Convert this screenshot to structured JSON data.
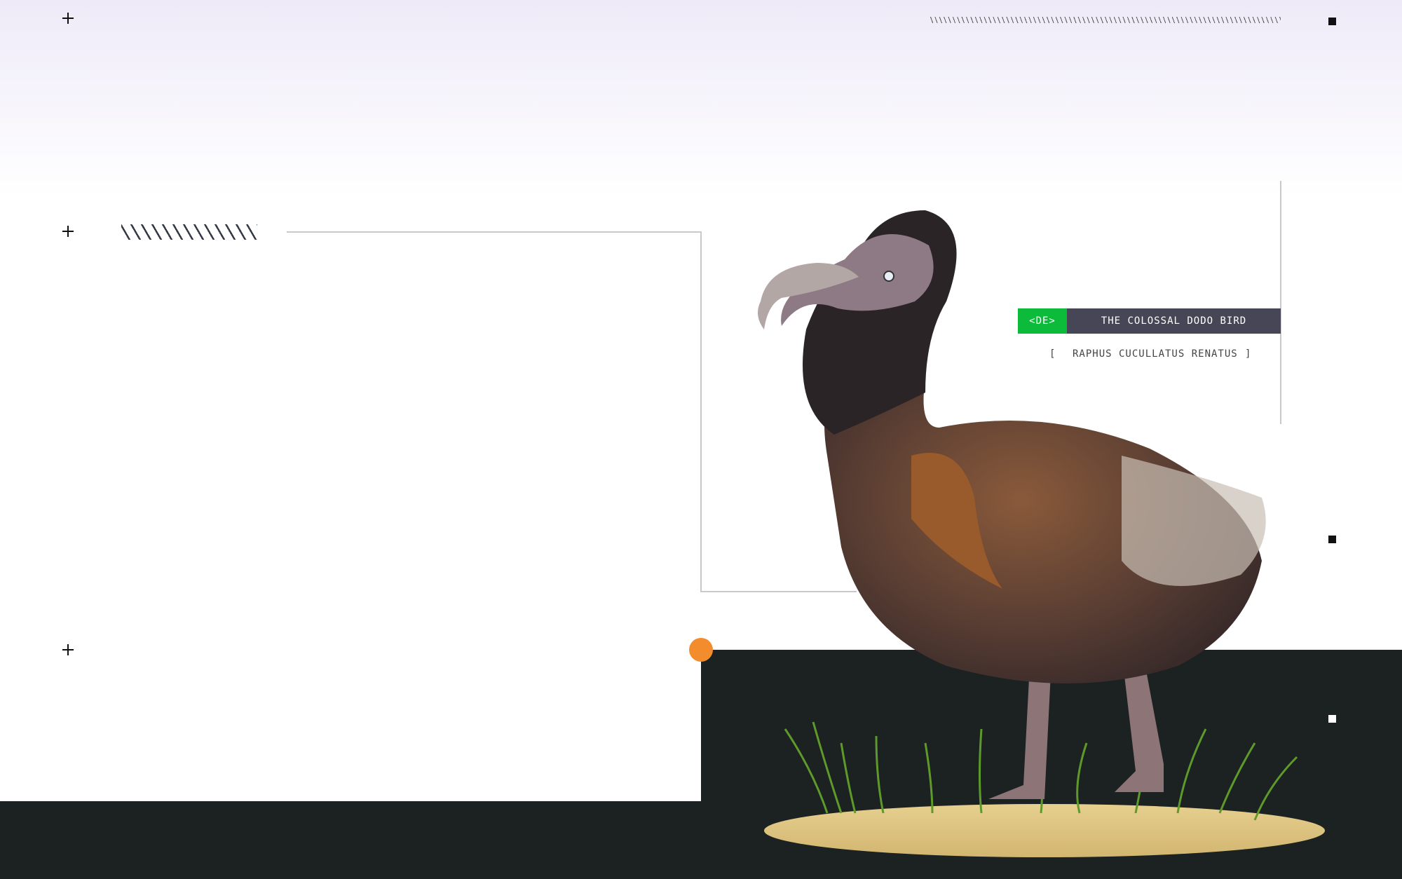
{
  "colors": {
    "accent_green": "#0dbb3a",
    "accent_orange": "#f28c2c",
    "dark_panel": "#1c2122",
    "tag_bg": "#474656"
  },
  "specimen": {
    "code": "<DE>",
    "title": "THE COLOSSAL DODO BIRD",
    "scientific_name": "RAPHUS CUCULLATUS RENATUS",
    "bracket_open": "[",
    "bracket_close": "]"
  },
  "icons": [
    "plus-icon",
    "square-marker-icon",
    "hatch-pattern"
  ]
}
